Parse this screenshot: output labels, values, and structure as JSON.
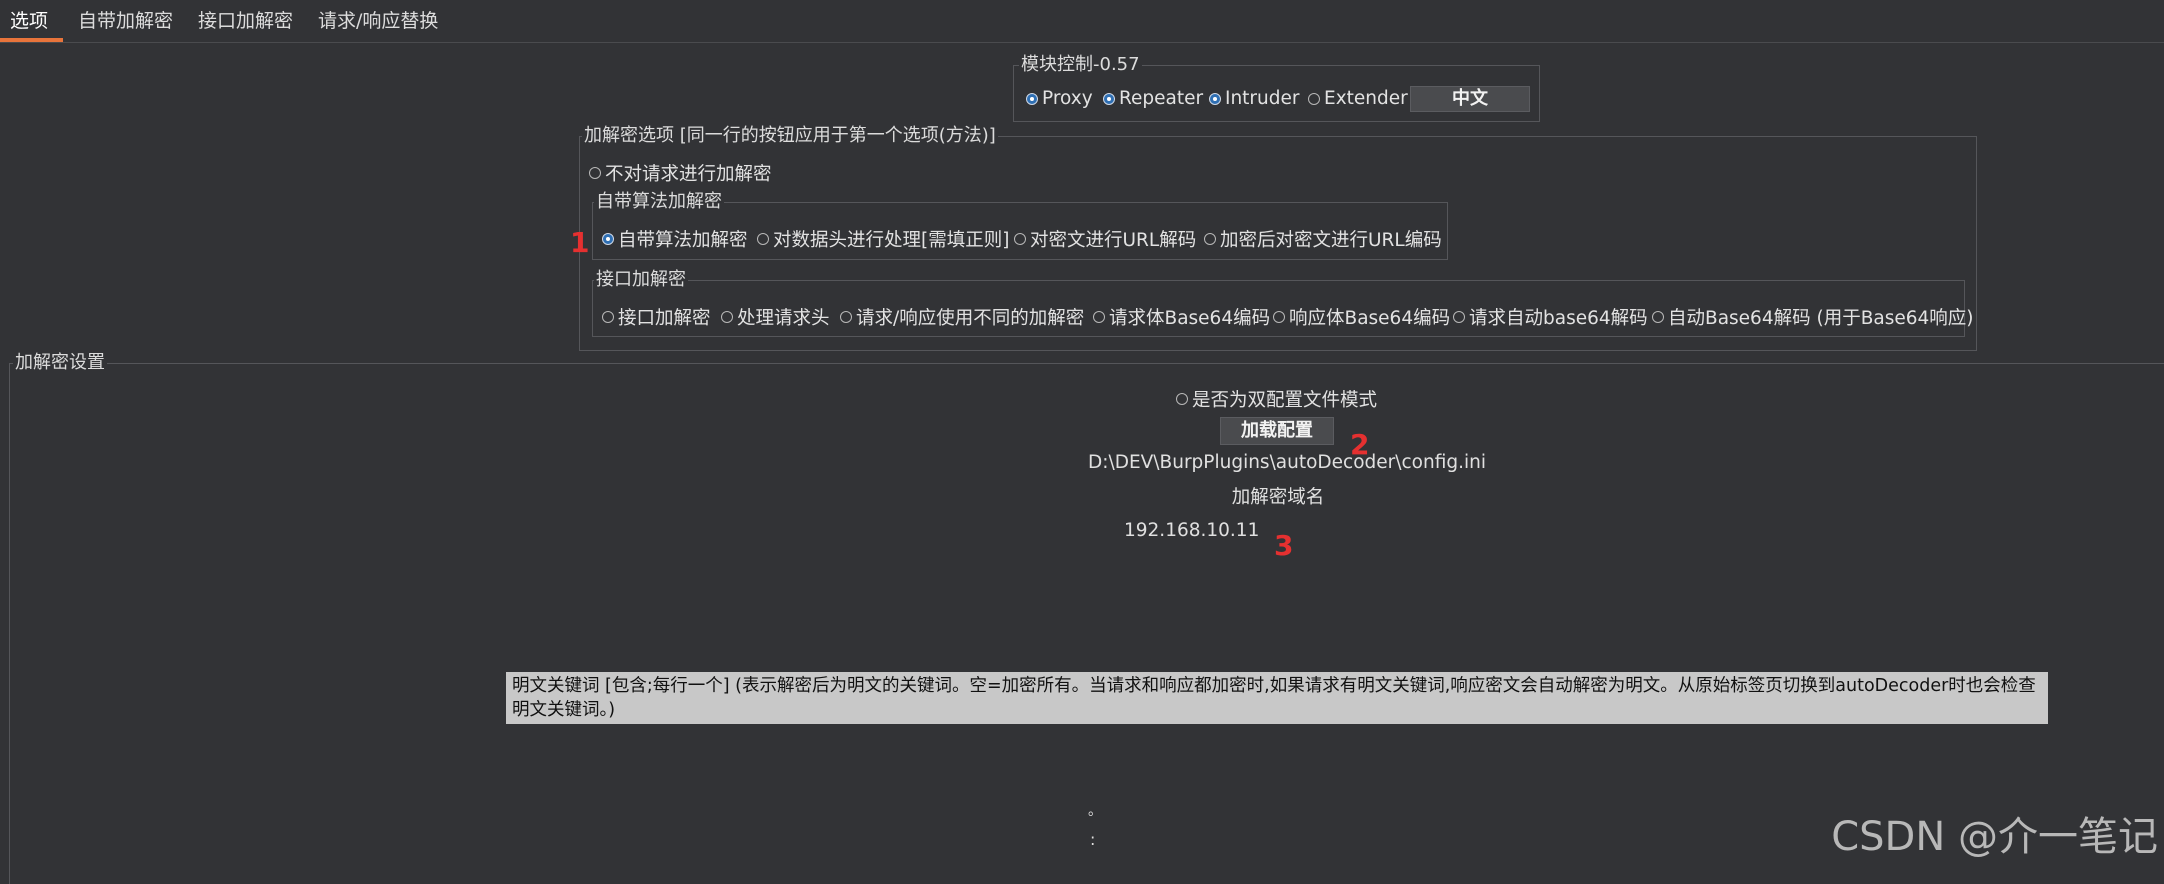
{
  "tabs": [
    "选项",
    "自带加解密",
    "接口加解密",
    "请求/响应替换"
  ],
  "module": {
    "legend": "模块控制-0.57",
    "options": [
      {
        "label": "Proxy",
        "checked": true
      },
      {
        "label": "Repeater",
        "checked": true
      },
      {
        "label": "Intruder",
        "checked": true
      },
      {
        "label": "Extender",
        "checked": false
      }
    ],
    "lang_button": "中文"
  },
  "crypto": {
    "legend": "加解密选项 [同一行的按钮应用于第一个选项(方法)]",
    "none_option": "不对请求进行加解密",
    "builtin": {
      "legend": "自带算法加解密",
      "options": [
        {
          "label": "自带算法加解密",
          "checked": true
        },
        {
          "label": "对数据头进行处理[需填正则]",
          "checked": false
        },
        {
          "label": "对密文进行URL解码",
          "checked": false
        },
        {
          "label": "加密后对密文进行URL编码",
          "checked": false
        }
      ]
    },
    "api": {
      "legend": "接口加解密",
      "options": [
        {
          "label": "接口加解密",
          "checked": false
        },
        {
          "label": "处理请求头",
          "checked": false
        },
        {
          "label": "请求/响应使用不同的加解密",
          "checked": false
        },
        {
          "label": "请求体Base64编码",
          "checked": false
        },
        {
          "label": "响应体Base64编码",
          "checked": false
        },
        {
          "label": "请求自动base64解码",
          "checked": false
        },
        {
          "label": "自动Base64解码 (用于Base64响应)",
          "checked": false
        }
      ]
    }
  },
  "settings": {
    "legend": "加解密设置",
    "dual_config": "是否为双配置文件模式",
    "load_button": "加载配置",
    "config_path": "D:\\DEV\\BurpPlugins\\autoDecoder\\config.ini",
    "domain_label": "加解密域名",
    "domain_value": "192.168.10.11",
    "keyword_note": "明文关键词 [包含;每行一个] (表示解密后为明文的关键词。空=加密所有。当请求和响应都加密时,如果请求有明文关键词,响应密文会自动解密为明文。从原始标签页切换到autoDecoder时也会检查明文关键词。)",
    "dot1": "。",
    "dot2": ":"
  },
  "markers": [
    "1",
    "2",
    "3"
  ],
  "watermark": "CSDN @介一笔记",
  "colors": {
    "accent": "#e8743b",
    "marker": "#e53030",
    "background": "#323336"
  }
}
